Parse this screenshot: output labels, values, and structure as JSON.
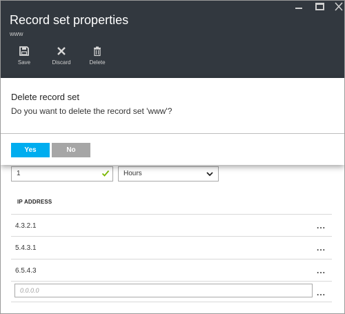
{
  "header": {
    "title": "Record set properties",
    "subtitle": "www",
    "toolbar": {
      "save_label": "Save",
      "discard_label": "Discard",
      "delete_label": "Delete"
    }
  },
  "dialog": {
    "title": "Delete record set",
    "message": "Do you want to delete the record set 'www'?",
    "yes_label": "Yes",
    "no_label": "No"
  },
  "form": {
    "ttl_value": "1",
    "ttl_unit": "Hours",
    "ip_column_header": "IP ADDRESS",
    "ip_addresses": [
      "4.3.2.1",
      "5.4.3.1",
      "6.5.4.3"
    ],
    "new_ip_placeholder": "0.0.0.0",
    "more_glyph": "..."
  },
  "colors": {
    "header_bg": "#32383f",
    "accent": "#00adef",
    "check": "#7ab800",
    "no_button": "#a6a6a6"
  }
}
